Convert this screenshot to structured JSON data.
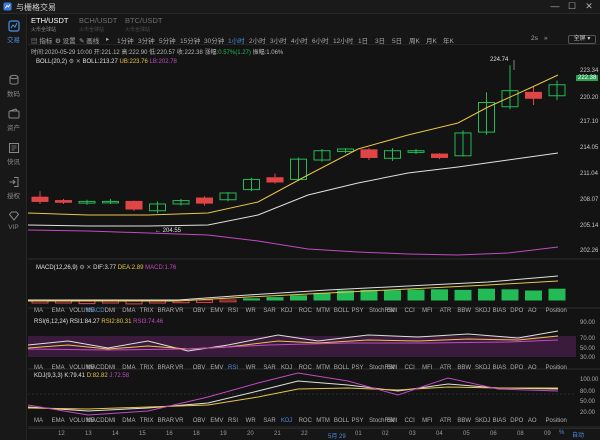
{
  "app": {
    "title": "与栅格交易"
  },
  "window_controls": [
    "—",
    "☐",
    "✕"
  ],
  "sidebar": {
    "items": [
      {
        "label": "交易",
        "icon": "chart-icon",
        "active": true
      },
      {
        "label": "数码",
        "icon": "database-icon",
        "active": false
      },
      {
        "label": "资产",
        "icon": "wallet-icon",
        "active": false
      },
      {
        "label": "快讯",
        "icon": "news-icon",
        "active": false
      },
      {
        "label": "授权",
        "icon": "login-icon",
        "active": false
      },
      {
        "label": "VIP",
        "icon": "diamond-icon",
        "active": false
      }
    ]
  },
  "pairs": [
    {
      "name": "ETH/USDT",
      "sub": "火币全球站",
      "active": true
    },
    {
      "name": "BCH/USDT",
      "sub": "火币全球站",
      "active": false
    },
    {
      "name": "BTC/USDT",
      "sub": "火币全球站",
      "active": false
    }
  ],
  "toolbar": {
    "indicator": "指标",
    "settings": "设置",
    "draw": "画线",
    "intervals": [
      "1分钟",
      "3分钟",
      "5分钟",
      "15分钟",
      "30分钟",
      "1小时",
      "2小时",
      "3小时",
      "4小时",
      "6小时",
      "12小时",
      "1日",
      "3日",
      "5日",
      "周K",
      "月K",
      "年K"
    ],
    "active_interval": "1小时",
    "extra": "2s",
    "fullscreen": "全屏"
  },
  "info": {
    "time": "时间:2020-05-29 10:00",
    "open": "开:221.12",
    "high": "高:222.90",
    "low": "低:220.57",
    "close": "收:222.38",
    "change_label": "涨幅:",
    "change": "0.57%(1.27)",
    "amplitude": "振幅:1.06%"
  },
  "boll_legend": {
    "name": "BOLL(20,2)",
    "boll": "BOLL:213.27",
    "ub": "UB:223.76",
    "lb": "LB:202.78"
  },
  "price_axis": [
    "223.34",
    "222.38",
    "220.20",
    "217.10",
    "214.05",
    "211.04",
    "208.07",
    "205.14",
    "202.26"
  ],
  "annotations": {
    "high_mark": "224.74",
    "low_mark": "← 204.55"
  },
  "macd_legend": {
    "name": "MACD(12,26,9)",
    "dif": "DIF:3.77",
    "dea": "DEA:2.89",
    "macd": "MACD:1.76"
  },
  "indicator_tabs": [
    "MA",
    "EMA",
    "VOLUME",
    "MACD",
    "DMI",
    "DMA",
    "TRIX",
    "BRAR",
    "VR",
    "OBV",
    "EMV",
    "RSI",
    "WR",
    "SAR",
    "KDJ",
    "ROC",
    "MTM",
    "BOLL",
    "PSY",
    "StochRSI",
    "SMI",
    "CCI",
    "MFI",
    "ATR",
    "BBW",
    "SKDJ",
    "BIAS",
    "DPO",
    "AO",
    "Position"
  ],
  "rsi_legend": {
    "name": "RSI(6,12,24)",
    "rsi1": "RSI1:84.27",
    "rsi2": "RSI2:80.31",
    "rsi3": "RSI3:74.46"
  },
  "rsi_axis": [
    "90.00",
    "70.00",
    "50.00",
    "30.00"
  ],
  "kdj_legend": {
    "name": "KDJ(9,3,3)",
    "k": "K:79.41",
    "d": "D:82.82",
    "j": "J:72.58"
  },
  "kdj_axis": [
    "100.00",
    "80.00",
    "50.00",
    "20.00"
  ],
  "x_axis": [
    "12",
    "13",
    "14",
    "15",
    "16",
    "18",
    "19",
    "20",
    "21",
    "22",
    "5月 29",
    "01",
    "02",
    "03",
    "04",
    "05",
    "06",
    "08",
    "09"
  ],
  "bottom_right": {
    "pct": "%",
    "log": "自动",
    "time": "1h 时"
  },
  "colors": {
    "up": "#22bb55",
    "down": "#e04545",
    "accent": "#4a90e2",
    "yellow": "#e8c54a",
    "magenta": "#c24bc4",
    "white": "#e0e0e0"
  }
}
